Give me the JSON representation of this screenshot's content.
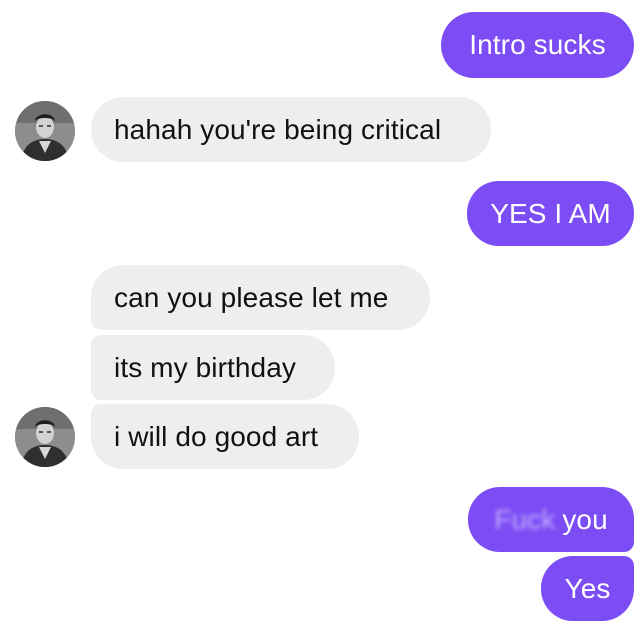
{
  "messages": {
    "m1": {
      "text": "Intro sucks"
    },
    "m2": {
      "text": "hahah you're being critical"
    },
    "m3": {
      "text": "YES I AM"
    },
    "m4": {
      "text": "can you please let me"
    },
    "m5": {
      "text": "its my birthday"
    },
    "m6": {
      "text": "i will do good art"
    },
    "m7": {
      "blurred": "Fuck",
      "text": "you"
    },
    "m8": {
      "text": "Yes"
    }
  },
  "colors": {
    "outgoing_bubble": "#7c4cf5",
    "incoming_bubble": "#eeeeef",
    "background": "#ffffff"
  },
  "icons": {
    "avatar": "contact-avatar-photo"
  }
}
